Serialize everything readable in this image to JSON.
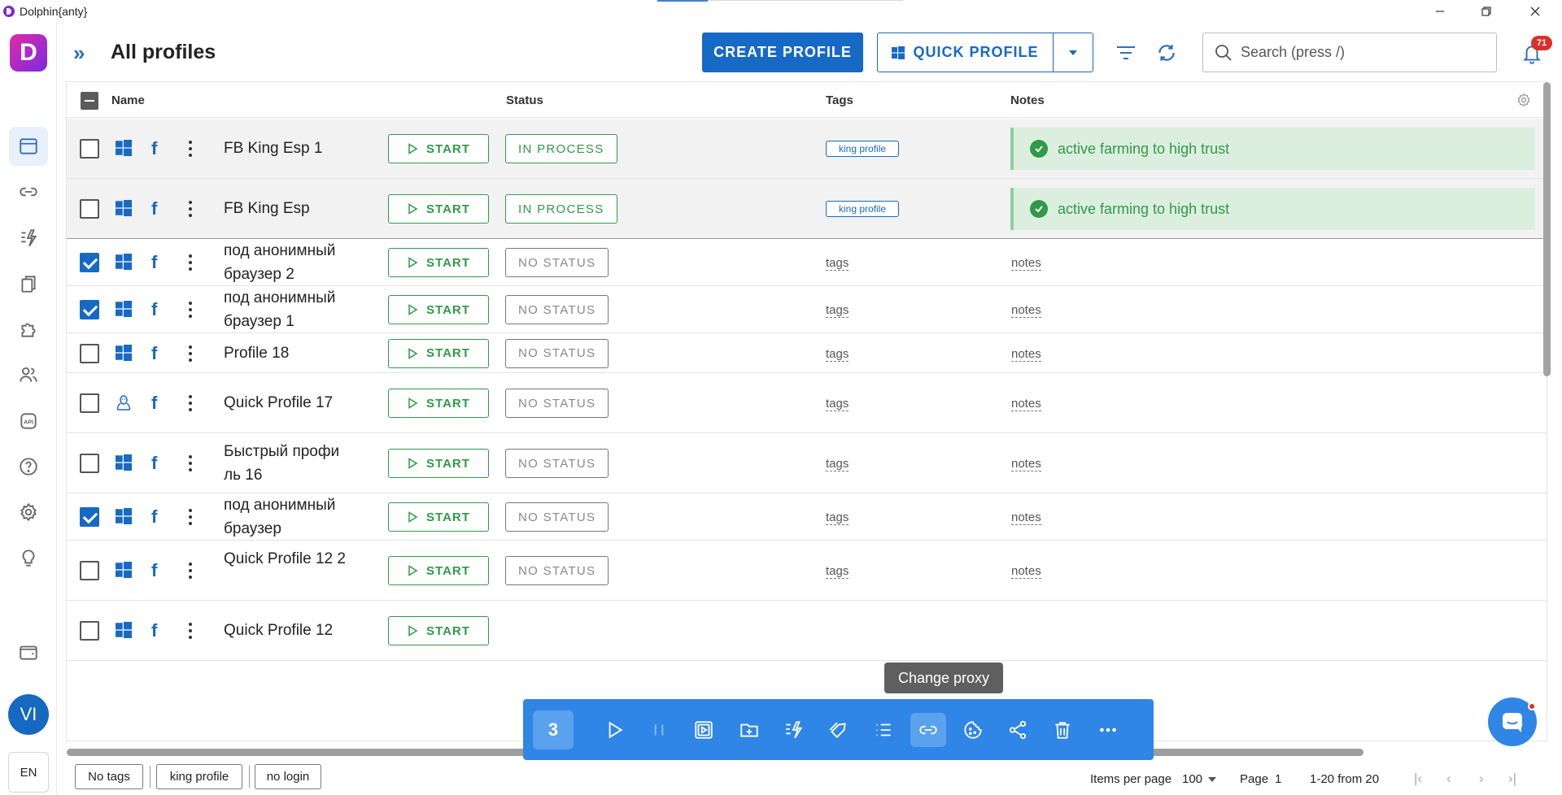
{
  "window": {
    "title": "Dolphin{anty}"
  },
  "header": {
    "title": "All profiles",
    "create_label": "CREATE PROFILE",
    "quick_label": "QUICK PROFILE",
    "search_placeholder": "Search (press /)",
    "notifications_count": "71"
  },
  "sidebar": {
    "items": [
      "browser-profiles",
      "proxies",
      "automation",
      "bookmarks",
      "extensions",
      "users",
      "api",
      "help",
      "settings",
      "ideas",
      "wallet"
    ],
    "avatar": "VI",
    "lang": "EN"
  },
  "table": {
    "columns": {
      "name": "Name",
      "status": "Status",
      "tags": "Tags",
      "notes": "Notes"
    },
    "start_label": "START",
    "tags_placeholder": "tags",
    "notes_placeholder": "notes",
    "rows": [
      {
        "name": "FB King Esp 1",
        "checked": false,
        "os": "windows",
        "status": "IN PROCESS",
        "tag": "king profile",
        "note": "active farming to high trust"
      },
      {
        "name": "FB King Esp",
        "checked": false,
        "os": "windows",
        "status": "IN PROCESS",
        "tag": "king profile",
        "note": "active farming to high trust"
      },
      {
        "name": "под анонимный браузер 2",
        "checked": true,
        "os": "windows",
        "status": "NO STATUS",
        "tag": "",
        "note": ""
      },
      {
        "name": "под анонимный браузер 1",
        "checked": true,
        "os": "windows",
        "status": "NO STATUS",
        "tag": "",
        "note": ""
      },
      {
        "name": "Profile 18",
        "checked": false,
        "os": "windows",
        "status": "NO STATUS",
        "tag": "",
        "note": ""
      },
      {
        "name": "Quick Profile 17",
        "checked": false,
        "os": "linux",
        "status": "NO STATUS",
        "tag": "",
        "note": ""
      },
      {
        "name": "Быстрый профи ль 16",
        "checked": false,
        "os": "windows",
        "status": "NO STATUS",
        "tag": "",
        "note": ""
      },
      {
        "name": "под анонимный браузер",
        "checked": true,
        "os": "windows",
        "status": "NO STATUS",
        "tag": "",
        "note": ""
      },
      {
        "name": "Quick Profile 12 2",
        "checked": false,
        "os": "windows",
        "status": "NO STATUS",
        "tag": "",
        "note": ""
      },
      {
        "name": "Quick Profile 12",
        "checked": false,
        "os": "windows",
        "status": "",
        "tag": "",
        "note": ""
      }
    ]
  },
  "bulk": {
    "count": "3",
    "tooltip": "Change proxy",
    "actions": [
      "start-icon",
      "pause-icon",
      "screenshot-icon",
      "add-folder-icon",
      "automation-icon",
      "tag-icon",
      "list-icon",
      "proxy-link-icon",
      "cookies-icon",
      "share-icon",
      "trash-icon",
      "more-icon"
    ]
  },
  "footer": {
    "filters": [
      "No tags",
      "king profile",
      "no login"
    ],
    "items_per_page_label": "Items per page",
    "items_per_page": "100",
    "page_label": "Page",
    "page": "1",
    "range": "1-20 from 20"
  },
  "colors": {
    "primary": "#1769c6",
    "success": "#2f9a47",
    "bulk": "#2f86e6",
    "note_bg": "#dcefdf"
  }
}
